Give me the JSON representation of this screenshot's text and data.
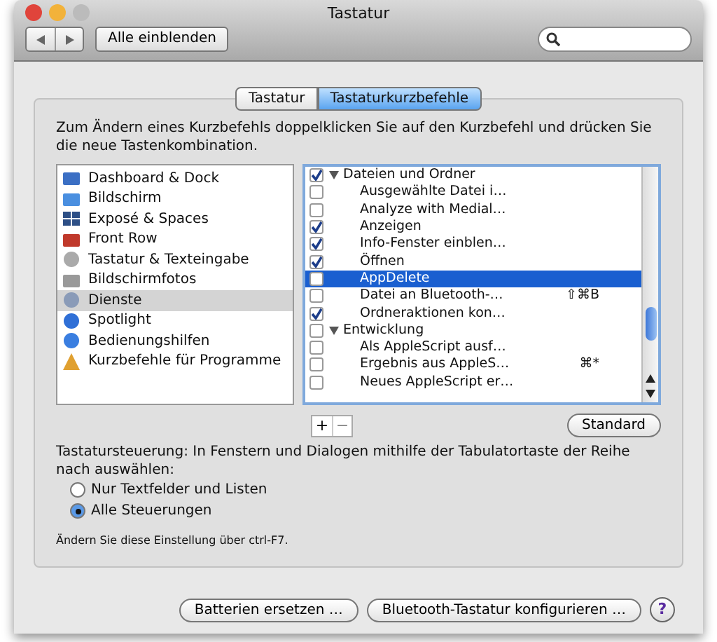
{
  "window": {
    "title": "Tastatur"
  },
  "toolbar": {
    "show_all_button": "Alle einblenden"
  },
  "tabs": [
    {
      "label": "Tastatur",
      "selected": false
    },
    {
      "label": "Tastaturkurzbefehle",
      "selected": true
    }
  ],
  "instructions": "Zum Ändern eines Kurzbefehls doppelklicken Sie auf den Kurzbefehl und drücken Sie die neue Tastenkombination.",
  "categories": [
    {
      "label": "Dashboard & Dock",
      "selected": false
    },
    {
      "label": "Bildschirm",
      "selected": false
    },
    {
      "label": "Exposé & Spaces",
      "selected": false
    },
    {
      "label": "Front Row",
      "selected": false
    },
    {
      "label": "Tastatur & Texteingabe",
      "selected": false
    },
    {
      "label": "Bildschirmfotos",
      "selected": false
    },
    {
      "label": "Dienste",
      "selected": true
    },
    {
      "label": "Spotlight",
      "selected": false
    },
    {
      "label": "Bedienungshilfen",
      "selected": false
    },
    {
      "label": "Kurzbefehle für Programme",
      "selected": false
    }
  ],
  "shortcuts": [
    {
      "label": "Dateien und Ordner",
      "checked": true,
      "expanded": true,
      "children": [
        {
          "label": "Ausgewählte Datei i…",
          "checked": false,
          "selected": false
        },
        {
          "label": "Analyze with Medial…",
          "checked": false,
          "selected": false
        },
        {
          "label": "Anzeigen",
          "checked": true,
          "selected": false
        },
        {
          "label": "Info-Fenster einblen…",
          "checked": true,
          "selected": false
        },
        {
          "label": "Öffnen",
          "checked": true,
          "selected": false
        },
        {
          "label": "AppDelete",
          "checked": false,
          "selected": true
        },
        {
          "label": "Datei an Bluetooth-…",
          "checked": false,
          "selected": false,
          "shortcut": "⇧⌘B"
        },
        {
          "label": "Ordneraktionen kon…",
          "checked": true,
          "selected": false
        }
      ]
    },
    {
      "label": "Entwicklung",
      "checked": false,
      "expanded": true,
      "children": [
        {
          "label": "Als AppleScript ausf…",
          "checked": false,
          "selected": false
        },
        {
          "label": "Ergebnis aus AppleS…",
          "checked": false,
          "selected": false,
          "shortcut": "⌘*"
        },
        {
          "label": "Neues AppleScript er…",
          "checked": false,
          "selected": false
        }
      ]
    }
  ],
  "list_buttons": [
    "+",
    "−"
  ],
  "standard_button": "Standard",
  "keyboard_control": {
    "label": "Tastatursteuerung: In Fenstern und Dialogen mithilfe der Tabulatortaste der Reihe nach auswählen:",
    "options": [
      {
        "label": "Nur Textfelder und Listen",
        "selected": false
      },
      {
        "label": "Alle Steuerungen",
        "selected": true
      }
    ],
    "note": "Ändern Sie diese Einstellung über ctrl-F7."
  },
  "footer_buttons": [
    "Batterien ersetzen …",
    "Bluetooth-Tastatur konfigurieren …"
  ],
  "help_button": "?"
}
